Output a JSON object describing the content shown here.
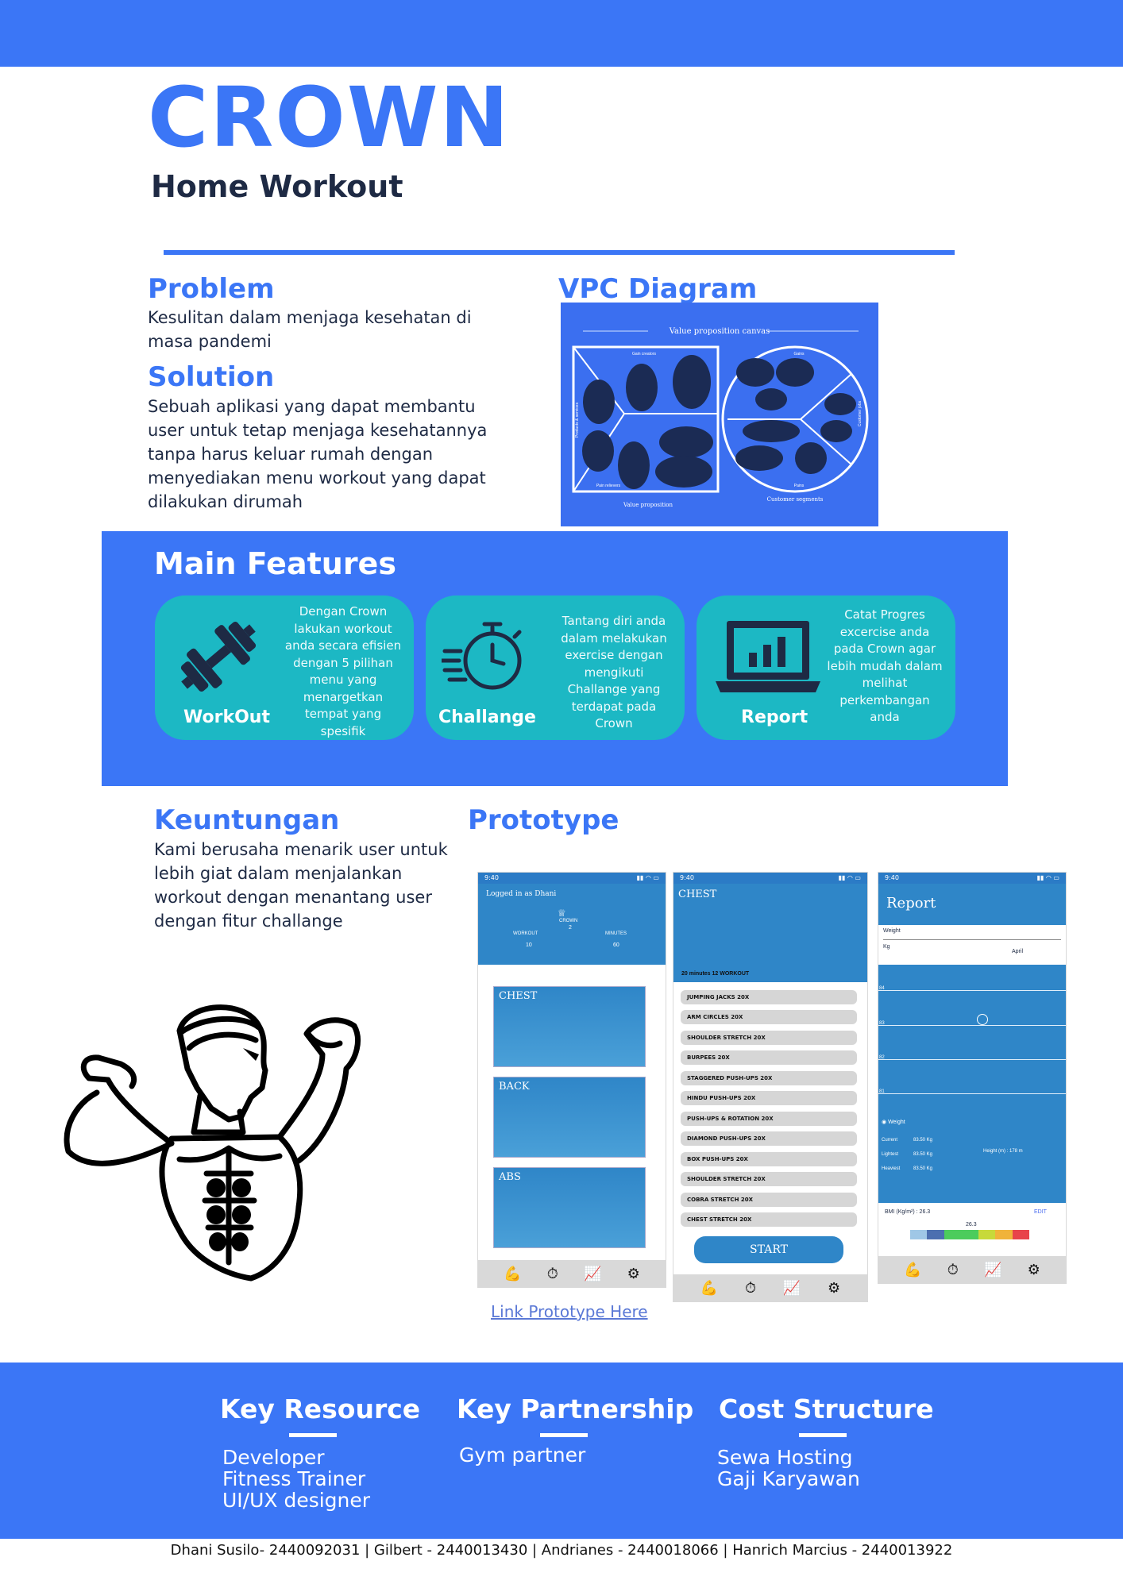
{
  "header": {
    "brand": "CROWN",
    "subtitle": "Home Workout"
  },
  "problem": {
    "title": "Problem",
    "text": " Kesulitan dalam menjaga kesehatan di masa pandemi"
  },
  "solution": {
    "title": "Solution",
    "text": "Sebuah aplikasi yang dapat membantu user untuk tetap menjaga kesehatannya tanpa harus keluar rumah dengan menyediakan menu workout yang dapat dilakukan dirumah"
  },
  "vpc": {
    "title": "VPC Diagram",
    "canvas_title": "Value proposition canvas",
    "gain_creators": "Gain creators",
    "pain_relievers": "Pain relievers",
    "products": "Products & services",
    "value_proposition": "Value proposition",
    "gains": "Gains",
    "pains": "Pains",
    "customer_jobs": "Customer jobs",
    "customer_segments": "Customer segments"
  },
  "features": {
    "title": "Main Features",
    "cards": [
      {
        "label": "WorkOut",
        "desc": "Dengan Crown lakukan workout anda secara efisien dengan 5 pilihan menu yang menargetkan tempat yang spesifik",
        "icon": "dumbbell-icon"
      },
      {
        "label": "Challange",
        "desc": "Tantang diri anda dalam melakukan exercise dengan mengikuti Challange yang terdapat pada Crown",
        "icon": "stopwatch-icon"
      },
      {
        "label": "Report",
        "desc": "Catat Progres excercise anda pada Crown agar lebih mudah dalam melihat perkembangan anda",
        "icon": "laptop-chart-icon"
      }
    ]
  },
  "keuntungan": {
    "title": "Keuntungan",
    "text": "Kami berusaha menarik user untuk lebih giat dalam menjalankan workout dengan menantang user dengan fitur challange"
  },
  "prototype": {
    "title": "Prototype",
    "link": "Link Prototype Here",
    "time": "9:40",
    "screen1": {
      "logged": "Logged in as Dhani",
      "crown": "CROWN",
      "workout_label": "WORKOUT",
      "workout_value": "10",
      "level_value": "2",
      "minutes_label": "MINUTES",
      "minutes_value": "60",
      "tiles": [
        "CHEST",
        "BACK",
        "ABS"
      ]
    },
    "screen2": {
      "title": "CHEST",
      "summary": "20 minutes 12 WORKOUT",
      "exercises": [
        "JUMPING JACKS  20X",
        "ARM CIRCLES 20X",
        "SHOULDER STRETCH 20X",
        "BURPEES  20X",
        "STAGGERED PUSH-UPS  20X",
        "HINDU PUSH-UPS  20X",
        "PUSH-UPS & ROTATION  20X",
        "DIAMOND PUSH-UPS  20X",
        "BOX PUSH-UPS 20X",
        "SHOULDER STRETCH 20X",
        "COBRA STRETCH 20X",
        "CHEST STRETCH  20X"
      ],
      "start": "START"
    },
    "screen3": {
      "title": "Report",
      "weight_label": "Weight",
      "unit": "Kg",
      "month": "April",
      "y_ticks": [
        "84",
        "83",
        "82",
        "81"
      ],
      "legend": "Weight",
      "current_label": "Current",
      "current_value": "83.50 Kg",
      "lightest_label": "Lightest",
      "lightest_value": "83.50 Kg",
      "heaviest_label": "Heaviest",
      "heaviest_value": "83.50 Kg",
      "height": "Height (m) : 178 m",
      "bmi": "BMI (Kg/m²) : 26.3",
      "edit": "EDIT",
      "bmi_value": "26.3"
    }
  },
  "bottom": {
    "key_resource": {
      "title": "Key Resource",
      "items": [
        "Developer",
        "Fitness Trainer",
        "UI/UX designer"
      ]
    },
    "key_partnership": {
      "title": "Key Partnership",
      "items": [
        "Gym partner"
      ]
    },
    "cost_structure": {
      "title": "Cost Structure",
      "items": [
        "Sewa Hosting",
        "Gaji Karyawan"
      ]
    }
  },
  "footer": "Dhani Susilo- 2440092031 | Gilbert - 2440013430 | Andrianes - 2440018066 | Hanrich Marcius - 2440013922",
  "colors": {
    "brand_blue": "#3b76f6",
    "teal": "#1cb8c4",
    "navy": "#1e2a44"
  }
}
